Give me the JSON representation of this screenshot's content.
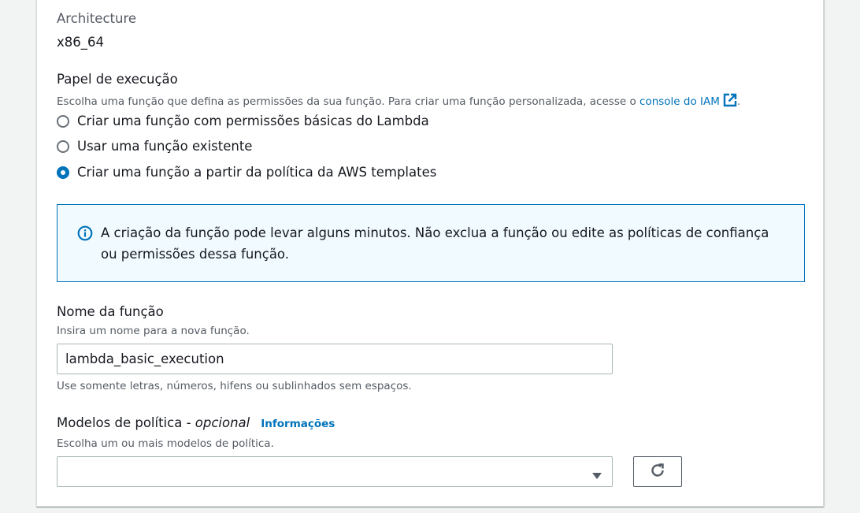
{
  "architecture": {
    "label": "Architecture",
    "value": "x86_64"
  },
  "execution_role": {
    "label": "Papel de execução",
    "description_prefix": "Escolha uma função que defina as permissões da sua função. Para criar uma função personalizada, acesse o ",
    "description_link": "console do IAM",
    "description_suffix": ".",
    "options": [
      {
        "label": "Criar uma função com permissões básicas do Lambda",
        "selected": false
      },
      {
        "label": "Usar uma função existente",
        "selected": false
      },
      {
        "label": "Criar uma função a partir da política da AWS templates",
        "selected": true
      }
    ]
  },
  "info_alert": {
    "text": "A criação da função pode levar alguns minutos. Não exclua a função ou edite as políticas de confiança ou permissões dessa função."
  },
  "role_name": {
    "label": "Nome da função",
    "description": "Insira um nome para a nova função.",
    "value": "lambda_basic_execution",
    "constraint": "Use somente letras, números, hifens ou sublinhados sem espaços."
  },
  "policy_templates": {
    "label": "Modelos de política - ",
    "optional": "opcional",
    "info_link": "Informações",
    "description": "Escolha um ou mais modelos de política.",
    "selected_value": ""
  },
  "colors": {
    "accent": "#0073bb",
    "info_bg": "#f1faff"
  },
  "icons": {
    "external_link": "external-link-icon",
    "info": "info-circle-icon",
    "dropdown": "caret-down-icon",
    "refresh": "refresh-icon"
  }
}
